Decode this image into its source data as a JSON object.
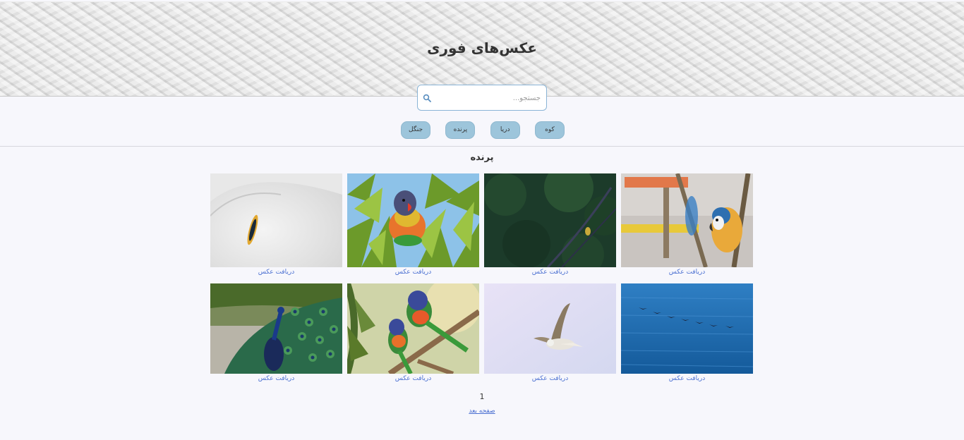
{
  "header": {
    "title": "عکس‌های فوری"
  },
  "search": {
    "placeholder": "جستجو..."
  },
  "categories": [
    {
      "label": "کوه"
    },
    {
      "label": "دریا"
    },
    {
      "label": "پرنده"
    },
    {
      "label": "جنگل"
    }
  ],
  "section": {
    "title": "پرنده"
  },
  "photos": [
    {
      "subject": "macaw-parrots",
      "download_label": "دریافت عکس"
    },
    {
      "subject": "small-bird-on-rope",
      "download_label": "دریافت عکس"
    },
    {
      "subject": "rainbow-lorikeet-in-tree",
      "download_label": "دریافت عکس"
    },
    {
      "subject": "white-bird-eye-closeup",
      "download_label": "دریافت عکس"
    },
    {
      "subject": "birds-over-sea",
      "download_label": "دریافت عکس"
    },
    {
      "subject": "seagull-flying",
      "download_label": "دریافت عکس"
    },
    {
      "subject": "two-lorikeets-on-branch",
      "download_label": "دریافت عکس"
    },
    {
      "subject": "peacock",
      "download_label": "دریافت عکس"
    }
  ],
  "pagination": {
    "current_page": "1",
    "next_label": "صفحه بعد"
  },
  "colors": {
    "category_chip": "#9dc5db",
    "link": "#4a6fd1",
    "search_border": "#8ab4d6"
  }
}
